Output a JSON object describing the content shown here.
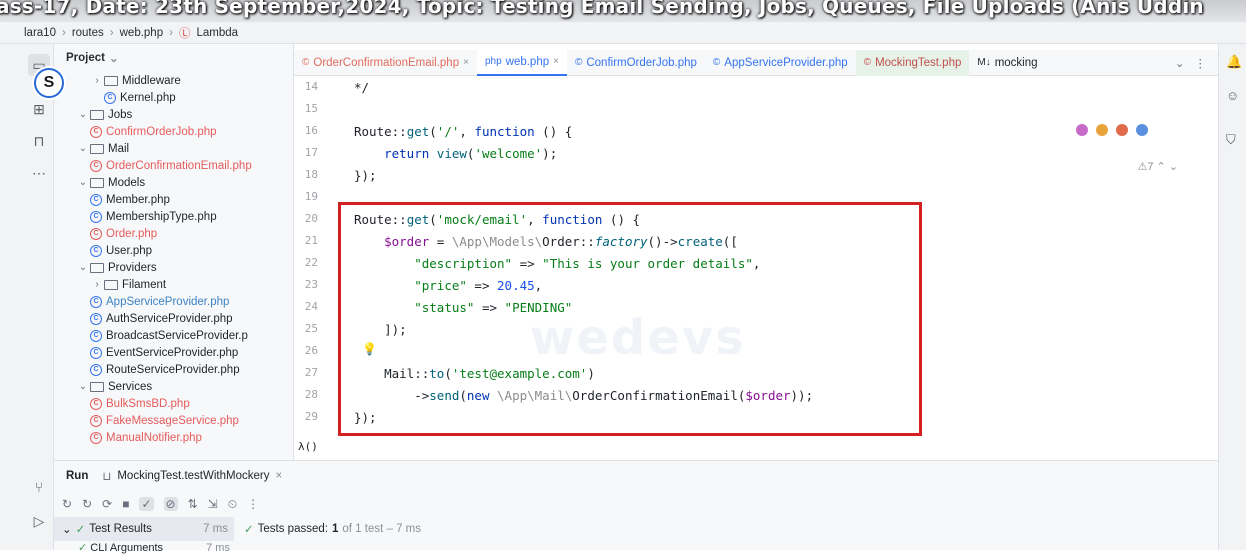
{
  "overlay_title": "ass-17, Date: 23th September,2024, Topic: Testing Email Sending, Jobs, Queues, File Uploads (Anis Uddin",
  "breadcrumb": [
    "lara10",
    "routes",
    "web.php",
    "Lambda"
  ],
  "project_panel": {
    "title": "Project",
    "tree": [
      {
        "label": "Middleware",
        "type": "folder",
        "arrow": "›",
        "indent": 2,
        "tone": ""
      },
      {
        "label": "Kernel.php",
        "type": "class",
        "indent": 3,
        "tone": ""
      },
      {
        "label": "Jobs",
        "type": "folder",
        "arrow": "⌄",
        "indent": 1,
        "tone": ""
      },
      {
        "label": "ConfirmOrderJob.php",
        "type": "class",
        "indent": 2,
        "tone": "red"
      },
      {
        "label": "Mail",
        "type": "folder",
        "arrow": "⌄",
        "indent": 1,
        "tone": ""
      },
      {
        "label": "OrderConfirmationEmail.php",
        "type": "class",
        "indent": 2,
        "tone": "red"
      },
      {
        "label": "Models",
        "type": "folder",
        "arrow": "⌄",
        "indent": 1,
        "tone": ""
      },
      {
        "label": "Member.php",
        "type": "class",
        "indent": 2,
        "tone": ""
      },
      {
        "label": "MembershipType.php",
        "type": "class",
        "indent": 2,
        "tone": ""
      },
      {
        "label": "Order.php",
        "type": "class",
        "indent": 2,
        "tone": "red"
      },
      {
        "label": "User.php",
        "type": "class",
        "indent": 2,
        "tone": ""
      },
      {
        "label": "Providers",
        "type": "folder",
        "arrow": "⌄",
        "indent": 1,
        "tone": ""
      },
      {
        "label": "Filament",
        "type": "folder",
        "arrow": "›",
        "indent": 2,
        "tone": ""
      },
      {
        "label": "AppServiceProvider.php",
        "type": "class",
        "indent": 2,
        "tone": "blue"
      },
      {
        "label": "AuthServiceProvider.php",
        "type": "class",
        "indent": 2,
        "tone": ""
      },
      {
        "label": "BroadcastServiceProvider.p",
        "type": "class",
        "indent": 2,
        "tone": ""
      },
      {
        "label": "EventServiceProvider.php",
        "type": "class",
        "indent": 2,
        "tone": ""
      },
      {
        "label": "RouteServiceProvider.php",
        "type": "class",
        "indent": 2,
        "tone": ""
      },
      {
        "label": "Services",
        "type": "folder",
        "arrow": "⌄",
        "indent": 1,
        "tone": ""
      },
      {
        "label": "BulkSmsBD.php",
        "type": "class",
        "indent": 2,
        "tone": "red"
      },
      {
        "label": "FakeMessageService.php",
        "type": "class",
        "indent": 2,
        "tone": "red"
      },
      {
        "label": "ManualNotifier.php",
        "type": "class",
        "indent": 2,
        "tone": "red"
      }
    ]
  },
  "tabs": [
    {
      "label": "OrderConfirmationEmail.php",
      "icon": "©",
      "tone": "red",
      "close": "×"
    },
    {
      "label": "web.php",
      "icon": "php",
      "tone": "active",
      "close": "×"
    },
    {
      "label": "ConfirmOrderJob.php",
      "icon": "©",
      "tone": "blue",
      "close": ""
    },
    {
      "label": "AppServiceProvider.php",
      "icon": "©",
      "tone": "blue-light",
      "close": ""
    },
    {
      "label": "MockingTest.php",
      "icon": "©",
      "tone": "green",
      "close": ""
    },
    {
      "label": "mocking",
      "icon": "M↓",
      "tone": "",
      "close": ""
    }
  ],
  "editor": {
    "line_numbers": [
      "14",
      "15",
      "16",
      "17",
      "18",
      "19",
      "20",
      "21",
      "22",
      "23",
      "24",
      "25",
      "26",
      "27",
      "28",
      "29"
    ],
    "inspection": "⚠7",
    "watermark": "wedevs",
    "gutter_symbol": "λ()"
  },
  "run_panel": {
    "run_label": "Run",
    "config_tab": "MockingTest.testWithMockery",
    "test_results_label": "Test Results",
    "test_results_time": "7 ms",
    "tests_passed_prefix": "Tests passed:",
    "tests_passed_count": "1",
    "tests_passed_suffix": "of 1 test – 7 ms",
    "cli_args": "CLI Arguments",
    "cli_time": "7 ms"
  }
}
